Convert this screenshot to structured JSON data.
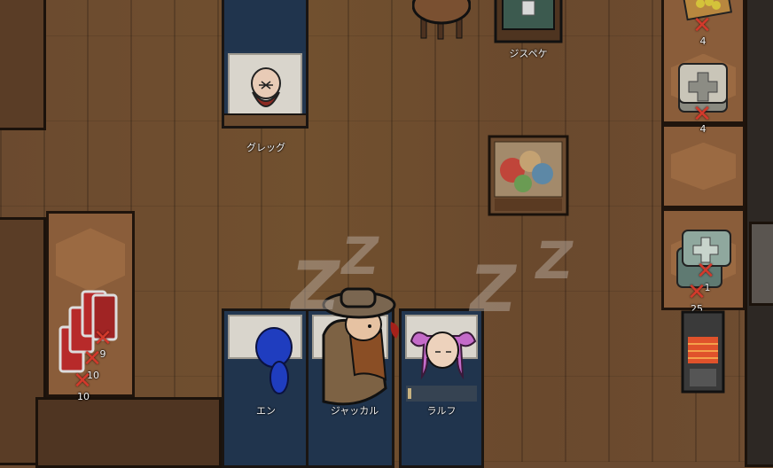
{
  "colonists": {
    "greg": "グレッグ",
    "en": "エン",
    "jackal": "ジャッカル",
    "ralph": "ラルフ",
    "jispeke": "ジスペケ"
  },
  "stacks": {
    "top_right_1": "4",
    "top_right_medicine": "4",
    "right_medicine_a": "1",
    "right_medicine_b": "25",
    "left_books_a": "9",
    "left_books_b": "10",
    "left_books_c": "10"
  },
  "sleep_indicator": "Z",
  "ralph_rest_progress": 0.05,
  "colors": {
    "floor": "#6b4a2f",
    "bed_sheet": "#233750",
    "forbid_mark": "#d33a2c"
  }
}
